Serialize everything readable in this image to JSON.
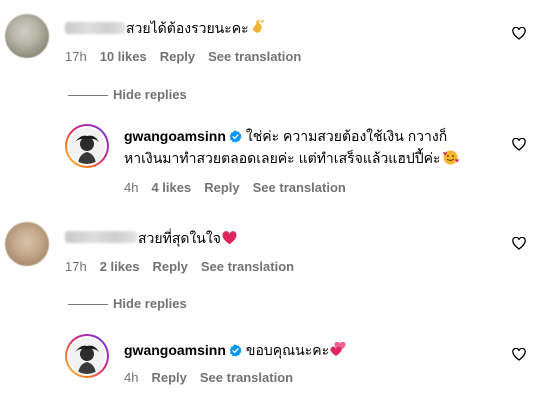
{
  "comments": [
    {
      "text": "สวยได้ต้องรวยนะคะ",
      "emoji": "clapping-hands",
      "time": "17h",
      "likes": "10 likes",
      "reply": "Reply",
      "translate": "See translation"
    },
    {
      "username": "gwangoamsinn",
      "text_line1": "ใช่ค่ะ ความสวยต้องใช้เงิน กวางก็",
      "text_line2": "หาเงินมาทำสวยตลอดเลยค่ะ แต่ทำเสร็จแล้วแฮปปี้ค่ะ",
      "emoji": "smiling-face-with-hearts",
      "time": "4h",
      "likes": "4 likes",
      "reply": "Reply",
      "translate": "See translation"
    },
    {
      "text": "สวยที่สุดในใจ",
      "emoji": "red-heart",
      "time": "17h",
      "likes": "2 likes",
      "reply": "Reply",
      "translate": "See translation"
    },
    {
      "username": "gwangoamsinn",
      "text": "ขอบคุณนะคะ",
      "emoji": "two-hearts",
      "time": "4h",
      "reply": "Reply",
      "translate": "See translation"
    }
  ],
  "hide_replies_label": "Hide replies",
  "colors": {
    "meta": "#737373",
    "verified": "#0095f6",
    "heart_emoji": "#e0245e"
  }
}
